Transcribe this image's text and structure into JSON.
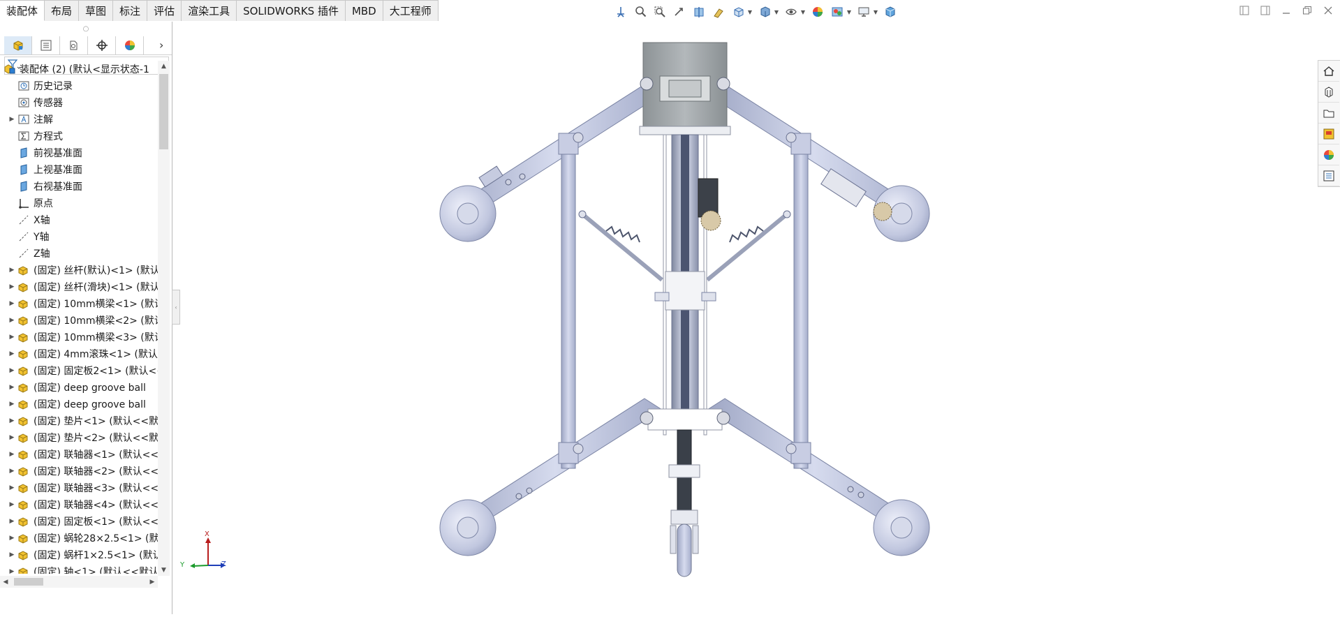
{
  "tabs": [
    {
      "label": "装配体",
      "active": true
    },
    {
      "label": "布局"
    },
    {
      "label": "草图"
    },
    {
      "label": "标注"
    },
    {
      "label": "评估"
    },
    {
      "label": "渲染工具"
    },
    {
      "label": "SOLIDWORKS 插件"
    },
    {
      "label": "MBD"
    },
    {
      "label": "大工程师"
    }
  ],
  "hud_icons": [
    "view-orientation-icon",
    "zoom-to-fit-icon",
    "zoom-to-area-icon",
    "previous-view-icon",
    "section-view-icon",
    "dynamic-annotation-icon",
    "view-orientation-cube-icon",
    "display-style-icon",
    "hide-show-icon",
    "edit-appearance-icon",
    "apply-scene-icon",
    "view-settings-icon",
    "3d-view-icon"
  ],
  "panel_tabs": [
    "featuremanager-tab",
    "propertymanager-tab",
    "configurationmanager-tab",
    "dimxpert-tab",
    "displaymanager-tab"
  ],
  "tree": {
    "root": "装配体 (2)  (默认<显示状态-1",
    "items": [
      {
        "label": "历史记录",
        "icon": "history-icon",
        "expandable": false
      },
      {
        "label": "传感器",
        "icon": "sensor-icon",
        "expandable": false
      },
      {
        "label": "注解",
        "icon": "annotation-icon",
        "expandable": true
      },
      {
        "label": "方程式",
        "icon": "equation-icon",
        "expandable": false
      },
      {
        "label": "前视基准面",
        "icon": "plane-icon",
        "expandable": false
      },
      {
        "label": "上视基准面",
        "icon": "plane-icon",
        "expandable": false
      },
      {
        "label": "右视基准面",
        "icon": "plane-icon",
        "expandable": false
      },
      {
        "label": "原点",
        "icon": "origin-icon",
        "expandable": false
      },
      {
        "label": "X轴",
        "icon": "axis-icon",
        "expandable": false
      },
      {
        "label": "Y轴",
        "icon": "axis-icon",
        "expandable": false
      },
      {
        "label": "Z轴",
        "icon": "axis-icon",
        "expandable": false
      },
      {
        "label": "(固定) 丝杆(默认)<1> (默认",
        "icon": "part-icon",
        "expandable": true
      },
      {
        "label": "(固定) 丝杆(滑块)<1> (默认",
        "icon": "part-icon",
        "expandable": true
      },
      {
        "label": "(固定) 10mm横梁<1> (默认",
        "icon": "part-icon",
        "expandable": true
      },
      {
        "label": "(固定) 10mm横梁<2> (默认",
        "icon": "part-icon",
        "expandable": true
      },
      {
        "label": "(固定) 10mm横梁<3> (默认",
        "icon": "part-icon",
        "expandable": true
      },
      {
        "label": "(固定) 4mm滚珠<1> (默认<",
        "icon": "part-icon",
        "expandable": true
      },
      {
        "label": "(固定) 固定板2<1> (默认<<",
        "icon": "part-icon",
        "expandable": true
      },
      {
        "label": "(固定) deep groove ball",
        "icon": "part-icon",
        "expandable": true
      },
      {
        "label": "(固定) deep groove ball",
        "icon": "part-icon",
        "expandable": true
      },
      {
        "label": "(固定) 垫片<1> (默认<<默",
        "icon": "part-icon",
        "expandable": true
      },
      {
        "label": "(固定) 垫片<2> (默认<<默",
        "icon": "part-icon",
        "expandable": true
      },
      {
        "label": "(固定) 联轴器<1> (默认<<",
        "icon": "part-icon",
        "expandable": true
      },
      {
        "label": "(固定) 联轴器<2> (默认<<",
        "icon": "part-icon",
        "expandable": true
      },
      {
        "label": "(固定) 联轴器<3> (默认<<",
        "icon": "part-icon",
        "expandable": true
      },
      {
        "label": "(固定) 联轴器<4> (默认<<",
        "icon": "part-icon",
        "expandable": true
      },
      {
        "label": "(固定) 固定板<1> (默认<<",
        "icon": "part-icon",
        "expandable": true
      },
      {
        "label": "(固定) 蜗轮28×2.5<1> (默",
        "icon": "part-icon",
        "expandable": true
      },
      {
        "label": "(固定) 蜗杆1×2.5<1> (默认",
        "icon": "part-icon",
        "expandable": true
      },
      {
        "label": "(固定) 轴<1> (默认<<默认",
        "icon": "part-icon",
        "expandable": true
      }
    ]
  },
  "task_pane": [
    "home-icon",
    "design-library-icon",
    "file-explorer-icon",
    "view-palette-icon",
    "appearances-icon",
    "custom-properties-icon"
  ],
  "triad": {
    "x": "X",
    "y": "Y",
    "z": "Z"
  },
  "colors": {
    "part_blue": "#b8bfd9",
    "motor_gray": "#a3a8ab",
    "accent": "#1f6fc4"
  }
}
